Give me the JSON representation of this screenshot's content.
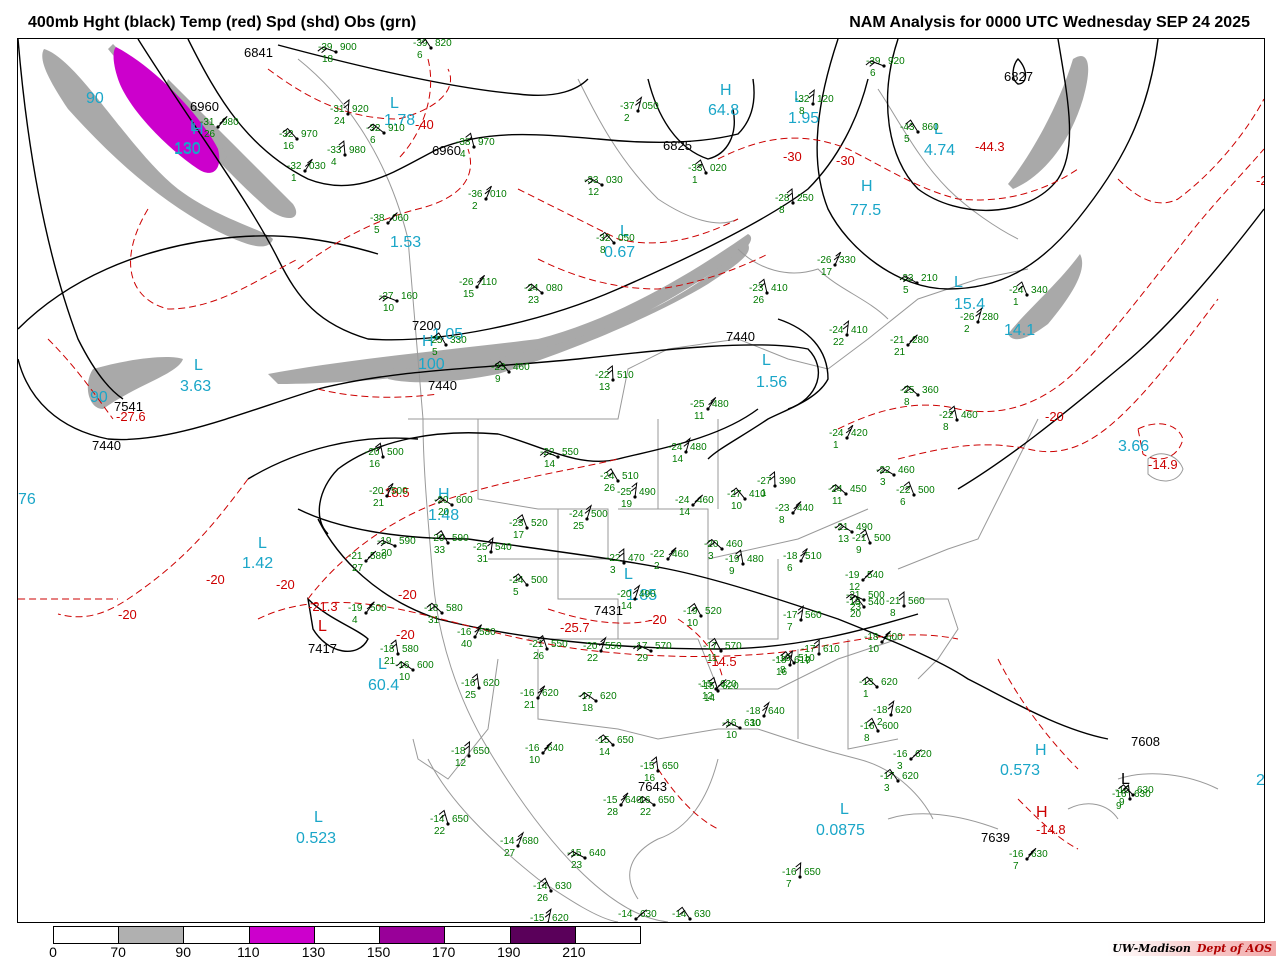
{
  "header": {
    "title_left": "400mb Hght (black) Temp (red) Spd (shd) Obs (grn)",
    "title_right": "NAM Analysis for 0000 UTC Wednesday  SEP 24 2025"
  },
  "colors": {
    "height_contour": "#000000",
    "temperature_contour": "#cc0000",
    "speed_label": "#1aa6c8",
    "observation": "#007a00",
    "border": "#999999",
    "shade_70_90": "#a9a9a9",
    "shade_110_130": "#cc00cc",
    "shade_150_170": "#990099",
    "shade_190_210": "#5a005a"
  },
  "legend": {
    "ticks": [
      "0",
      "70",
      "90",
      "110",
      "130",
      "150",
      "170",
      "190",
      "210"
    ],
    "segments": [
      "",
      "#b0b0b0",
      "",
      "#cc00cc",
      "",
      "#990099",
      "",
      "#5a005a",
      ""
    ]
  },
  "credit": {
    "org": "UW-Madison",
    "dept": "Dept of AOS"
  },
  "height_labels": [
    "6841",
    "6960",
    "6960",
    "6825",
    "6827",
    "7200",
    "7440",
    "7440",
    "7440",
    "7541",
    "7417",
    "7431",
    "7608",
    "7639",
    "7643"
  ],
  "temperature_labels": [
    "-20",
    "-20",
    "-20",
    "-20",
    "-20",
    "-20",
    "-30",
    "-30",
    "-40",
    "-20",
    "-44.3",
    "-21.3",
    "-18.5",
    "-25.7",
    "-27.6",
    "-14.5",
    "-14.8",
    "-14.9",
    "-20"
  ],
  "speed_labels": [
    "90",
    "130",
    "130",
    "1.78",
    "1.53",
    "0.67",
    "64.8",
    "1.95",
    "4.74",
    "77.5",
    "1.56",
    "1.05",
    "100",
    "3.63",
    "15.4",
    "14.1",
    "1.42",
    "1.48",
    "60.4",
    "0.523",
    "0.0875",
    "0.573",
    "1.85",
    "3.66",
    "76",
    "90",
    "2"
  ],
  "pressure_centers": [
    "L",
    "H",
    "L",
    "L",
    "H",
    "L",
    "L",
    "H",
    "L",
    "L",
    "L",
    "H",
    "L",
    "H",
    "L",
    "L",
    "L",
    "H",
    "L",
    "L",
    "H",
    "L"
  ],
  "observations": [
    {
      "t": "-39",
      "h": "900",
      "d": "18"
    },
    {
      "t": "-39",
      "h": "820",
      "d": "6"
    },
    {
      "t": "-31",
      "h": "920",
      "d": "24"
    },
    {
      "t": "-31",
      "h": "980",
      "d": "26"
    },
    {
      "t": "-32",
      "h": "970",
      "d": "16"
    },
    {
      "t": "-33",
      "h": "980",
      "d": "4"
    },
    {
      "t": "-32",
      "h": "030",
      "d": "1"
    },
    {
      "t": "-32",
      "h": "910",
      "d": "6"
    },
    {
      "t": "-38",
      "h": "970",
      "d": "4"
    },
    {
      "t": "-36",
      "h": "010",
      "d": "2"
    },
    {
      "t": "-33",
      "h": "030",
      "d": "12"
    },
    {
      "t": "-33",
      "h": "020",
      "d": "1"
    },
    {
      "t": "-37",
      "h": "050",
      "d": "2"
    },
    {
      "t": "-39",
      "h": "920",
      "d": "6"
    },
    {
      "t": "-43",
      "h": "860",
      "d": "5"
    },
    {
      "t": "-32",
      "h": "120",
      "d": "8"
    },
    {
      "t": "-38",
      "h": "060",
      "d": "5"
    },
    {
      "t": "-32",
      "h": "050",
      "d": "8"
    },
    {
      "t": "-28",
      "h": "250",
      "d": "8"
    },
    {
      "t": "-26",
      "h": "110",
      "d": "15"
    },
    {
      "t": "-24",
      "h": "080",
      "d": "23"
    },
    {
      "t": "-23",
      "h": "410",
      "d": "26"
    },
    {
      "t": "-26",
      "h": "330",
      "d": "17"
    },
    {
      "t": "-33",
      "h": "210",
      "d": "5"
    },
    {
      "t": "-24",
      "h": "340",
      "d": "1"
    },
    {
      "t": "-26",
      "h": "280",
      "d": "2"
    },
    {
      "t": "-27",
      "h": "160",
      "d": "10"
    },
    {
      "t": "-25",
      "h": "330",
      "d": "5"
    },
    {
      "t": "-24",
      "h": "410",
      "d": "22"
    },
    {
      "t": "-21",
      "h": "280",
      "d": "21"
    },
    {
      "t": "-23",
      "h": "460",
      "d": "9"
    },
    {
      "t": "-22",
      "h": "510",
      "d": "13"
    },
    {
      "t": "-25",
      "h": "480",
      "d": "11"
    },
    {
      "t": "-25",
      "h": "360",
      "d": "8"
    },
    {
      "t": "-22",
      "h": "460",
      "d": "8"
    },
    {
      "t": "-24",
      "h": "420",
      "d": "1"
    },
    {
      "t": "-22",
      "h": "460",
      "d": "3"
    },
    {
      "t": "-22",
      "h": "500",
      "d": "6"
    },
    {
      "t": "-24",
      "h": "480",
      "d": "14"
    },
    {
      "t": "-22",
      "h": "550",
      "d": "14"
    },
    {
      "t": "-24",
      "h": "510",
      "d": "26"
    },
    {
      "t": "-25",
      "h": "490",
      "d": "19"
    },
    {
      "t": "-24",
      "h": "460",
      "d": "14"
    },
    {
      "t": "-27",
      "h": "410",
      "d": "10"
    },
    {
      "t": "-27",
      "h": "390",
      "d": "1"
    },
    {
      "t": "-23",
      "h": "440",
      "d": "8"
    },
    {
      "t": "-24",
      "h": "450",
      "d": "11"
    },
    {
      "t": "-20",
      "h": "500",
      "d": "16"
    },
    {
      "t": "-20",
      "h": "500",
      "d": "21"
    },
    {
      "t": "-20",
      "h": "600",
      "d": "20"
    },
    {
      "t": "-23",
      "h": "520",
      "d": "17"
    },
    {
      "t": "-24",
      "h": "500",
      "d": "25"
    },
    {
      "t": "-19",
      "h": "590",
      "d": "20"
    },
    {
      "t": "-20",
      "h": "590",
      "d": "33"
    },
    {
      "t": "-25",
      "h": "540",
      "d": "31"
    },
    {
      "t": "-21",
      "h": "580",
      "d": "27"
    },
    {
      "t": "-24",
      "h": "500",
      "d": "5"
    },
    {
      "t": "-22",
      "h": "470",
      "d": "3"
    },
    {
      "t": "-22",
      "h": "460",
      "d": "2"
    },
    {
      "t": "-20",
      "h": "460",
      "d": "3"
    },
    {
      "t": "-19",
      "h": "480",
      "d": "9"
    },
    {
      "t": "-18",
      "h": "510",
      "d": "6"
    },
    {
      "t": "-21",
      "h": "490",
      "d": "13"
    },
    {
      "t": "-21",
      "h": "500",
      "d": "9"
    },
    {
      "t": "-20",
      "h": "490",
      "d": "14"
    },
    {
      "t": "-21",
      "h": "500",
      "d": "23"
    },
    {
      "t": "-19",
      "h": "520",
      "d": "10"
    },
    {
      "t": "-17",
      "h": "560",
      "d": "7"
    },
    {
      "t": "-19",
      "h": "540",
      "d": "12"
    },
    {
      "t": "-18",
      "h": "540",
      "d": "20"
    },
    {
      "t": "-21",
      "h": "560",
      "d": "8"
    },
    {
      "t": "-19",
      "h": "500",
      "d": "4"
    },
    {
      "t": "-18",
      "h": "580",
      "d": "31"
    },
    {
      "t": "-18",
      "h": "580",
      "d": "21"
    },
    {
      "t": "-16",
      "h": "580",
      "d": "40"
    },
    {
      "t": "-16",
      "h": "600",
      "d": "10"
    },
    {
      "t": "-21",
      "h": "550",
      "d": "26"
    },
    {
      "t": "-20",
      "h": "550",
      "d": "22"
    },
    {
      "t": "-17",
      "h": "570",
      "d": "29"
    },
    {
      "t": "-17",
      "h": "570",
      "d": "11"
    },
    {
      "t": "-18",
      "h": "610",
      "d": "16"
    },
    {
      "t": "-15",
      "h": "620",
      "d": "12"
    },
    {
      "t": "-18",
      "h": "510",
      "d": "8"
    },
    {
      "t": "-17",
      "h": "610",
      "d": "7"
    },
    {
      "t": "-18",
      "h": "600",
      "d": "10"
    },
    {
      "t": "-13",
      "h": "620",
      "d": "1"
    },
    {
      "t": "-16",
      "h": "620",
      "d": "25"
    },
    {
      "t": "-16",
      "h": "620",
      "d": "21"
    },
    {
      "t": "-17",
      "h": "620",
      "d": "18"
    },
    {
      "t": "-15",
      "h": "620",
      "d": "14"
    },
    {
      "t": "-18",
      "h": "640",
      "d": "10"
    },
    {
      "t": "-16",
      "h": "630",
      "d": "10"
    },
    {
      "t": "-16",
      "h": "600",
      "d": "8"
    },
    {
      "t": "-18",
      "h": "620",
      "d": "2"
    },
    {
      "t": "-16",
      "h": "620",
      "d": "3"
    },
    {
      "t": "-17",
      "h": "620",
      "d": "3"
    },
    {
      "t": "-18",
      "h": "650",
      "d": "12"
    },
    {
      "t": "-16",
      "h": "640",
      "d": "10"
    },
    {
      "t": "-15",
      "h": "650",
      "d": "14"
    },
    {
      "t": "-15",
      "h": "650",
      "d": "16"
    },
    {
      "t": "-15",
      "h": "640",
      "d": "28"
    },
    {
      "t": "-16",
      "h": "650",
      "d": "22"
    },
    {
      "t": "-14",
      "h": "650",
      "d": "22"
    },
    {
      "t": "-14",
      "h": "680",
      "d": "27"
    },
    {
      "t": "-15",
      "h": "640",
      "d": "23"
    },
    {
      "t": "-14",
      "h": "630",
      "d": "26"
    },
    {
      "t": "-15",
      "h": "620",
      "d": ""
    },
    {
      "t": "-14",
      "h": "630",
      "d": ""
    },
    {
      "t": "-14",
      "h": "630",
      "d": ""
    },
    {
      "t": "-16",
      "h": "650",
      "d": "7"
    },
    {
      "t": "-16",
      "h": "630",
      "d": "7"
    },
    {
      "t": "-16",
      "h": "630",
      "d": "9"
    },
    {
      "t": "-16",
      "h": "630",
      "d": "9"
    }
  ]
}
